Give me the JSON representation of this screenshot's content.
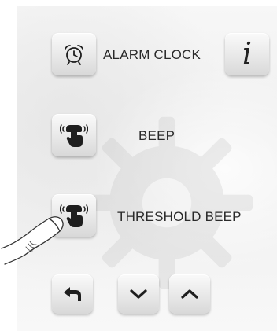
{
  "menu": {
    "items": [
      {
        "label": "ALARM CLOCK",
        "icon": "alarm-clock-icon"
      },
      {
        "label": "BEEP",
        "icon": "touch-beep-icon"
      },
      {
        "label": "THRESHOLD BEEP",
        "icon": "touch-beep-icon"
      }
    ]
  },
  "info_button": {
    "glyph": "i",
    "icon": "info-icon"
  },
  "nav": {
    "back": {
      "icon": "back-arrow-icon"
    },
    "down": {
      "icon": "chevron-down-icon"
    },
    "up": {
      "icon": "chevron-up-icon"
    }
  },
  "colors": {
    "background": "#f2f2f2",
    "button_top": "#fafafa",
    "button_bottom": "#d8d8d8",
    "icon_dark": "#1e1e1e",
    "text": "#2a2a2a"
  }
}
